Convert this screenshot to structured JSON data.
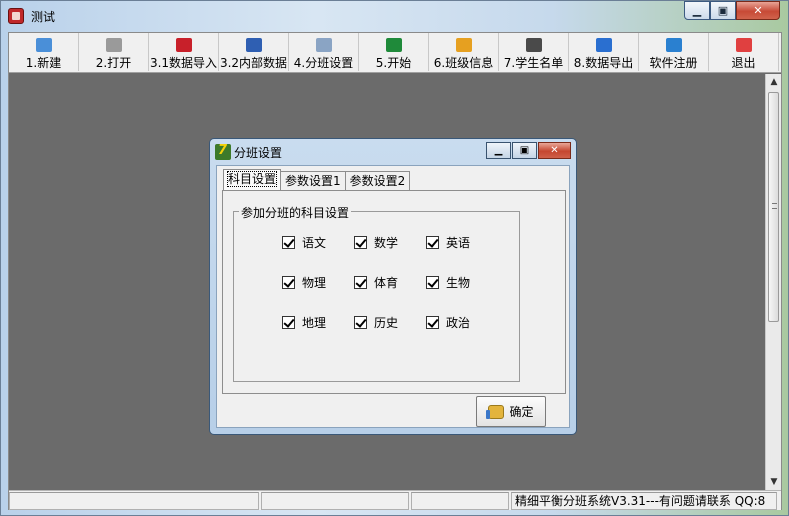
{
  "window": {
    "title": "测试"
  },
  "toolbar": [
    {
      "label": "1.新建",
      "icon": "new-document-icon",
      "color": "#4a8fd8",
      "width": 70
    },
    {
      "label": "2.打开",
      "icon": "open-icon",
      "color": "#9a9a9a",
      "width": 70
    },
    {
      "label": "3.1数据导入",
      "icon": "data-import-icon",
      "color": "#c8202a",
      "width": 70
    },
    {
      "label": "3.2内部数据",
      "icon": "internal-data-icon",
      "color": "#2f5fb2",
      "width": 70
    },
    {
      "label": "4.分班设置",
      "icon": "gear-icon",
      "color": "#8aa4c4",
      "width": 70
    },
    {
      "label": "5.开始",
      "icon": "start-icon",
      "color": "#1f8a3a",
      "width": 70
    },
    {
      "label": "6.班级信息",
      "icon": "class-info-icon",
      "color": "#e6a020",
      "width": 70
    },
    {
      "label": "7.学生名单",
      "icon": "student-list-icon",
      "color": "#4a4a4a",
      "width": 70
    },
    {
      "label": "8.数据导出",
      "icon": "data-export-icon",
      "color": "#2a6fd0",
      "width": 70
    },
    {
      "label": "软件注册",
      "icon": "register-icon",
      "color": "#2a80d0",
      "width": 70
    },
    {
      "label": "退出",
      "icon": "exit-icon",
      "color": "#e04040",
      "width": 70
    }
  ],
  "statusbar": {
    "panels": [
      "",
      "",
      "",
      "精细平衡分班系统V3.31---有问题请联系 QQ:8"
    ]
  },
  "dialog": {
    "title": "分班设置",
    "tabs": [
      "科目设置",
      "参数设置1",
      "参数设置2"
    ],
    "active_tab": 0,
    "group_title": "参加分班的科目设置",
    "subjects": [
      {
        "label": "语文",
        "checked": true
      },
      {
        "label": "数学",
        "checked": true
      },
      {
        "label": "英语",
        "checked": true
      },
      {
        "label": "物理",
        "checked": true
      },
      {
        "label": "体育",
        "checked": true
      },
      {
        "label": "生物",
        "checked": true
      },
      {
        "label": "地理",
        "checked": true
      },
      {
        "label": "历史",
        "checked": true
      },
      {
        "label": "政治",
        "checked": true
      }
    ],
    "ok_label": "确定"
  }
}
